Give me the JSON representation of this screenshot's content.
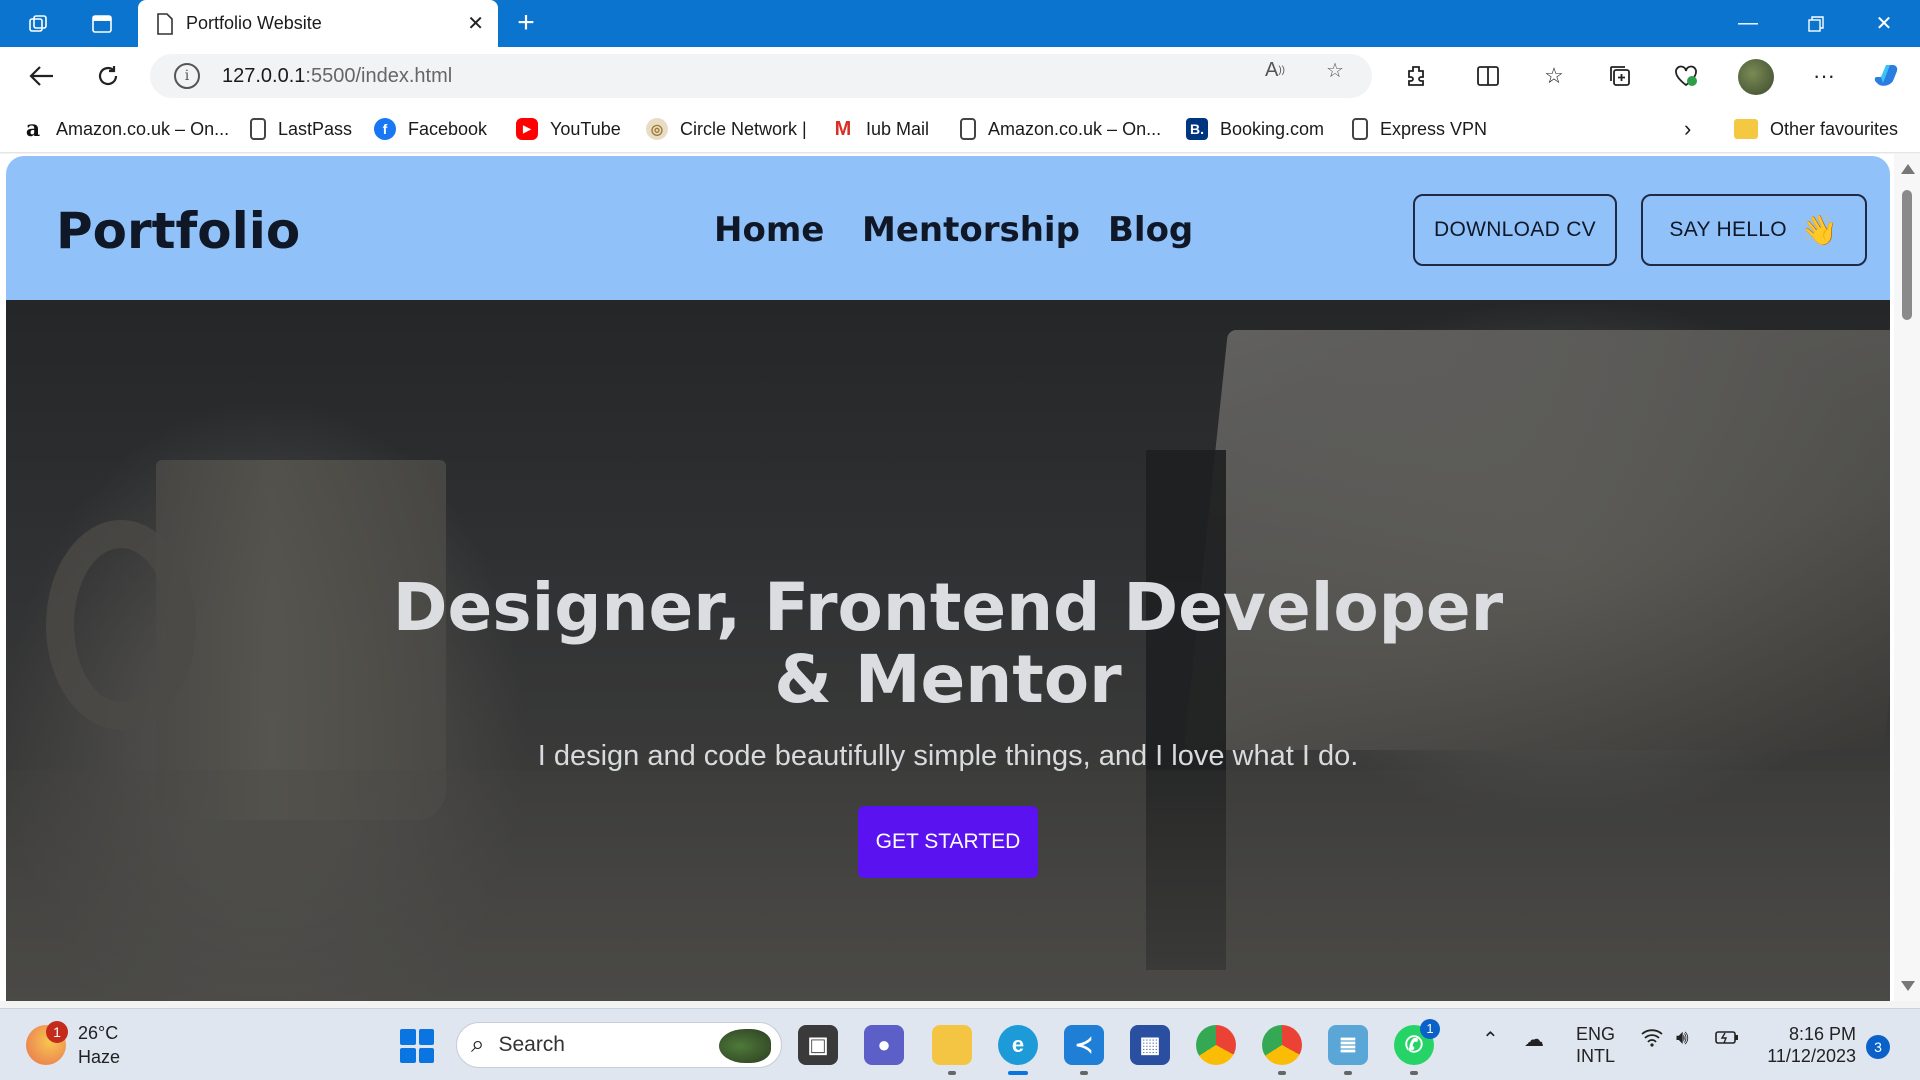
{
  "browser": {
    "tab_title": "Portfolio Website",
    "url_host": "127.0.0.1",
    "url_path": ":5500/index.html"
  },
  "favorites": [
    {
      "label": "Amazon.co.uk – On...",
      "icon": "amazon-icon"
    },
    {
      "label": "LastPass",
      "icon": "document-icon"
    },
    {
      "label": "Facebook",
      "icon": "facebook-icon"
    },
    {
      "label": "YouTube",
      "icon": "youtube-icon"
    },
    {
      "label": "Circle Network |",
      "icon": "circle-network-icon"
    },
    {
      "label": "Iub Mail",
      "icon": "gmail-icon"
    },
    {
      "label": "Amazon.co.uk – On...",
      "icon": "document-icon"
    },
    {
      "label": "Booking.com",
      "icon": "booking-icon"
    },
    {
      "label": "Express VPN",
      "icon": "document-icon"
    }
  ],
  "other_favourites": "Other favourites",
  "site": {
    "logo": "Portfolio",
    "nav": [
      "Home",
      "Mentorship",
      "Blog"
    ],
    "download_cv": "DOWNLOAD CV",
    "say_hello": "SAY HELLO",
    "hero_title_line1": "Designer, Frontend Developer",
    "hero_title_line2": "& Mentor",
    "hero_subtitle": "I design and code beautifully simple things, and I love what I do.",
    "cta": "GET STARTED"
  },
  "taskbar": {
    "weather_temp": "26°C",
    "weather_desc": "Haze",
    "weather_badge": "1",
    "search_placeholder": "Search",
    "lang_line1": "ENG",
    "lang_line2": "INTL",
    "time": "8:16 PM",
    "date": "11/12/2023",
    "notifications": "3",
    "whatsapp_badge": "1"
  },
  "colors": {
    "titlebar": "#0a74cf",
    "header_bg": "#90c2f9",
    "cta_bg": "#5b12f0",
    "logo_text": "#101828"
  }
}
